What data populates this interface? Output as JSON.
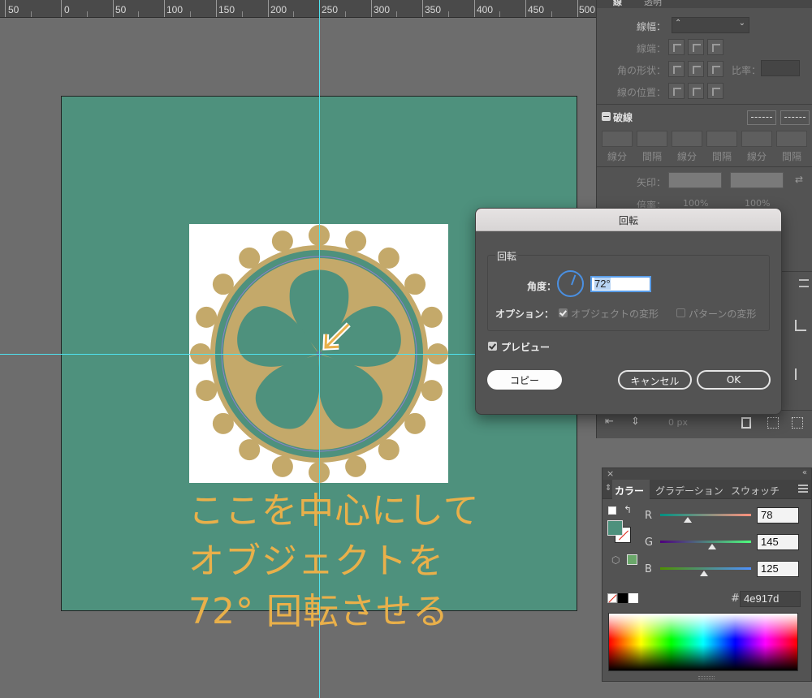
{
  "ruler": {
    "labels": [
      "50",
      "0",
      "50",
      "100",
      "150",
      "200",
      "250",
      "300",
      "350",
      "400",
      "450",
      "500"
    ]
  },
  "caption": {
    "line1": "ここを中心にして",
    "line2": "オブジェクトを",
    "line3": "72° 回転させる"
  },
  "stroke_panel": {
    "tab1": "線",
    "tab2": "透明",
    "weight_label": "線幅：",
    "cap_label": "線端：",
    "corner_label": "角の形状：",
    "limit_label": "比率：",
    "align_label": "線の位置：",
    "dash_title": "破線",
    "dash_labels": [
      "線分",
      "間隔",
      "線分",
      "間隔",
      "線分",
      "間隔"
    ],
    "arrow_label": "矢印：",
    "scale_label": "倍率：",
    "scale1": "100%",
    "scale2": "100%",
    "offset": "0 px"
  },
  "rotate_dialog": {
    "title": "回転",
    "group_title": "回転",
    "angle_label": "角度：",
    "angle_value": "72°",
    "options_label": "オプション：",
    "opt_objects": "オブジェクトの変形",
    "opt_patterns": "パターンの変形",
    "preview_label": "プレビュー",
    "copy_button": "コピー",
    "cancel_button": "キャンセル",
    "ok_button": "OK"
  },
  "color_panel": {
    "tab_color": "カラー",
    "tab_gradient": "グラデーション",
    "tab_swatches": "スウォッチ",
    "r_label": "R",
    "g_label": "G",
    "b_label": "B",
    "r_value": "78",
    "g_value": "145",
    "b_value": "125",
    "hash": "#",
    "hex_value": "4e917d"
  },
  "colors": {
    "artboard": "#4e917d",
    "emblem_gold": "#c4a96a",
    "caption": "#e9b04a",
    "guide": "#4fe3f0"
  }
}
